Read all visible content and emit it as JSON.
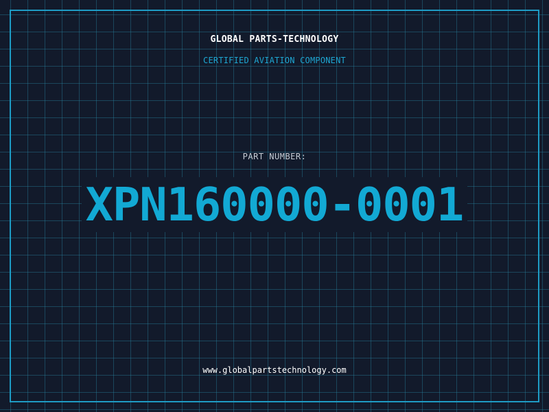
{
  "brand": {
    "title": "GLOBAL PARTS-TECHNOLOGY",
    "subtitle": "CERTIFIED AVIATION COMPONENT"
  },
  "part": {
    "label": "PART NUMBER:",
    "number": "XPN160000-0001"
  },
  "footer": {
    "website": "www.globalpartstechnology.com"
  },
  "colors": {
    "background": "#121a2b",
    "grid": "#28829f",
    "accent": "#1e9cc5",
    "title_text": "#ffffff",
    "label_text": "#c6cdd6"
  }
}
